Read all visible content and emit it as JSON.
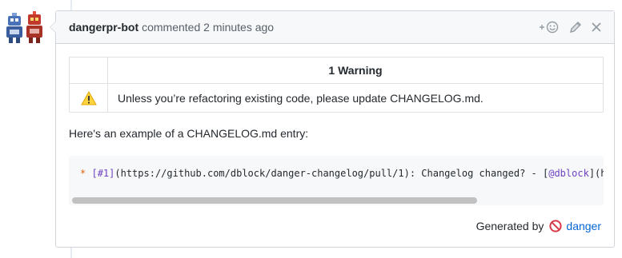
{
  "comment": {
    "author": "dangerpr-bot",
    "action_text": "commented 2 minutes ago",
    "header_icons": [
      "add-reaction-icon",
      "pencil-icon",
      "close-icon"
    ]
  },
  "warnings_table": {
    "header": "1 Warning",
    "rows": [
      {
        "icon": "warning-icon",
        "message": "Unless you’re refactoring existing code, please update CHANGELOG.md."
      }
    ]
  },
  "example": {
    "intro": "Here's an example of a CHANGELOG.md entry:",
    "code": {
      "bullet": "*",
      "ref": "[#1]",
      "text_mid": "(https://github.com/dblock/danger-changelog/pull/1): Changelog changed? - [",
      "mention": "@dblock",
      "text_end": "](h"
    },
    "scrollbar_position": 0
  },
  "footer": {
    "prefix": "Generated by",
    "icon": "no-entry-icon",
    "link": "danger"
  },
  "colors": {
    "link": "#0366d6",
    "warning_yellow": "#ffd33d",
    "danger_red": "#d73a49",
    "border": "#d1d5da"
  }
}
